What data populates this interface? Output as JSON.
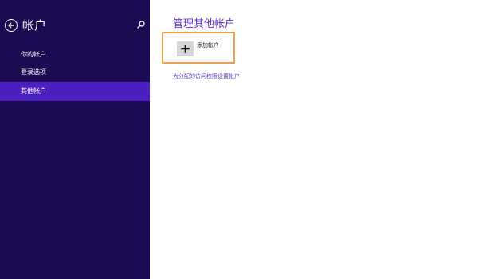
{
  "sidebar": {
    "title": "帐户",
    "back_icon": "back-arrow-icon",
    "search_icon": "search-icon",
    "background": "#1c0a52",
    "active_background": "#4c1fc1",
    "items": [
      {
        "label": "你的帐户",
        "active": false
      },
      {
        "label": "登录选项",
        "active": false
      },
      {
        "label": "其他帐户",
        "active": true
      }
    ]
  },
  "main": {
    "title": "管理其他帐户",
    "add_account": {
      "label": "添加帐户",
      "icon": "plus-icon",
      "highlight_color": "#f0a04a"
    },
    "assigned_access_link": "为分配的访问权限设置帐户",
    "accent_color": "#5e2dc4"
  }
}
